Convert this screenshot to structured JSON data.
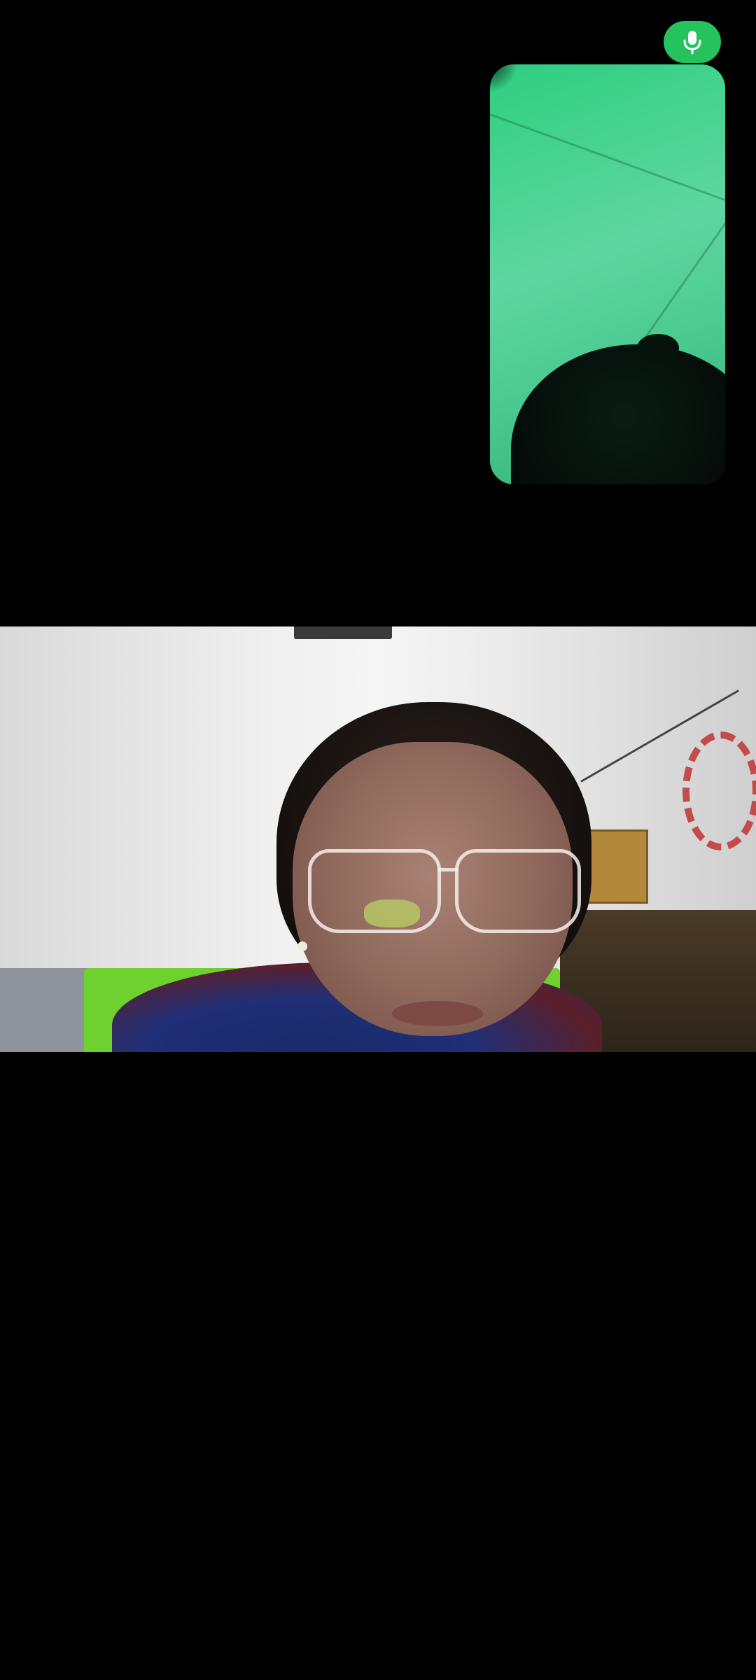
{
  "call": {
    "mic_status": {
      "icon": "microphone-icon",
      "state": "on",
      "color": "#25c25e"
    },
    "self_view": {
      "description_icon": "self-camera-view"
    },
    "remote_view": {
      "description_icon": "remote-participant-video"
    }
  }
}
